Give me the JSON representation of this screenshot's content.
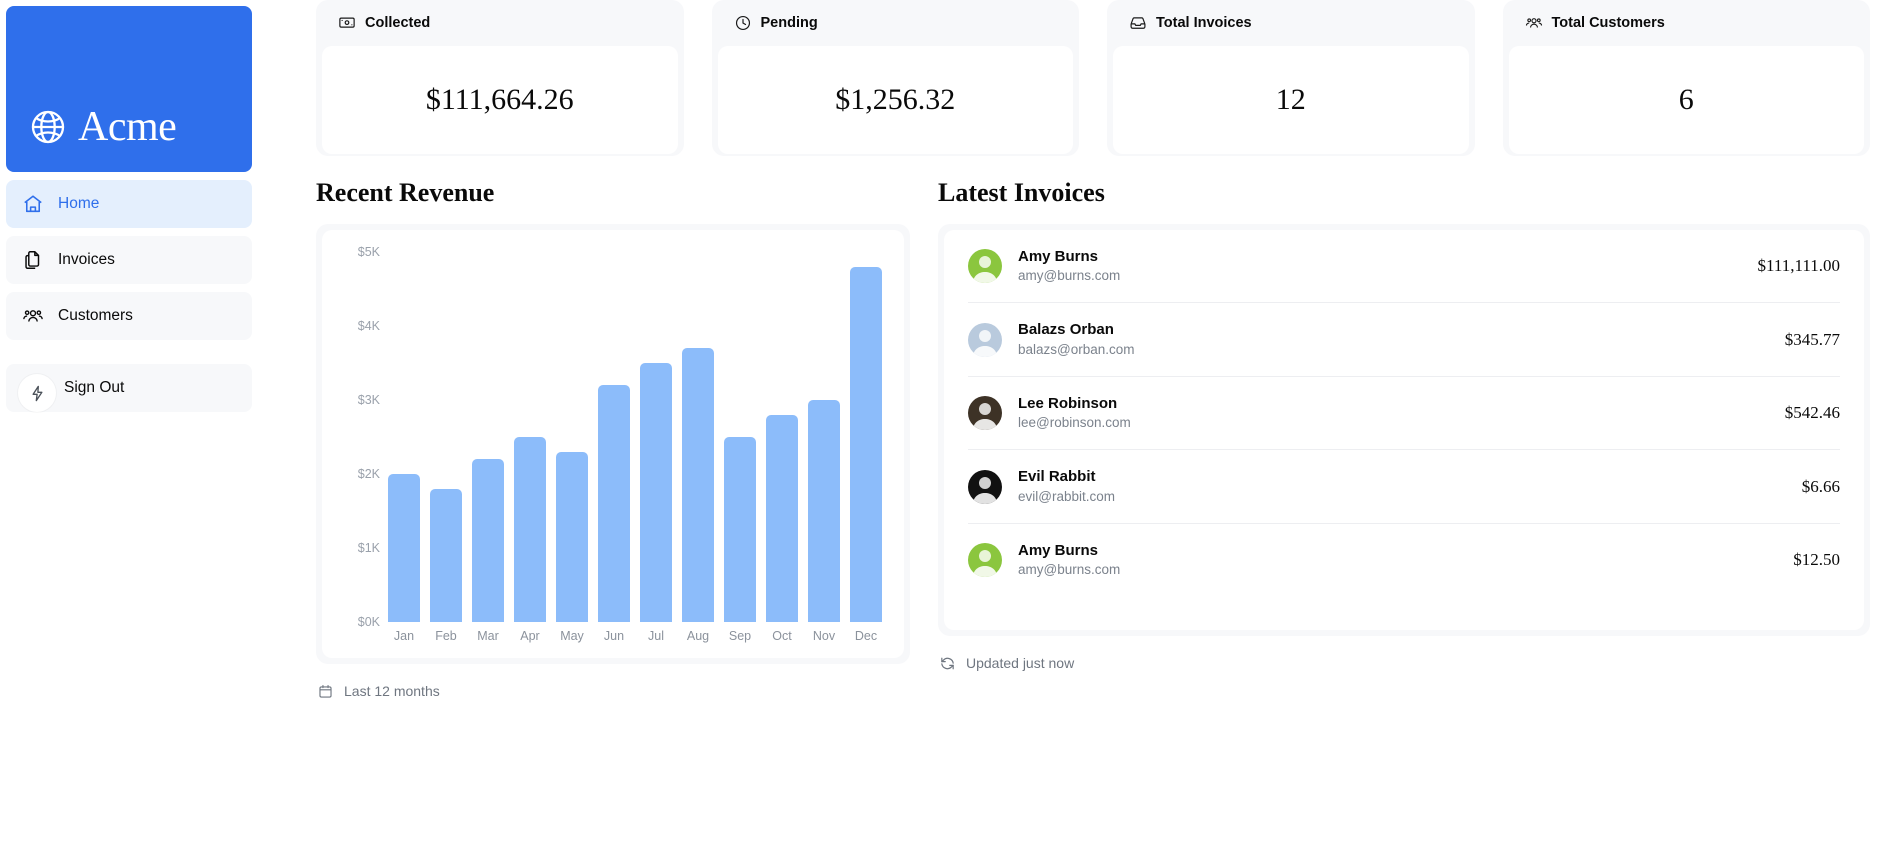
{
  "sidebar": {
    "logo": {
      "text": "Acme",
      "icon": "globe-icon",
      "bg_color": "#2f6feb"
    },
    "items": [
      {
        "label": "Home",
        "icon": "home-icon",
        "active": true
      },
      {
        "label": "Invoices",
        "icon": "documents-icon",
        "active": false
      },
      {
        "label": "Customers",
        "icon": "users-icon",
        "active": false
      }
    ],
    "sign_out": {
      "label": "Sign Out",
      "icon": "power-icon"
    }
  },
  "cards": [
    {
      "label": "Collected",
      "icon": "banknotes-icon",
      "value": "$111,664.26"
    },
    {
      "label": "Pending",
      "icon": "clock-icon",
      "value": "$1,256.32"
    },
    {
      "label": "Total Invoices",
      "icon": "inbox-icon",
      "value": "12"
    },
    {
      "label": "Total Customers",
      "icon": "users-icon",
      "value": "6"
    }
  ],
  "revenue": {
    "title": "Recent Revenue",
    "footer": {
      "label": "Last 12 months",
      "icon": "calendar-icon"
    }
  },
  "invoices": {
    "title": "Latest Invoices",
    "footer": {
      "label": "Updated just now",
      "icon": "refresh-icon"
    },
    "rows": [
      {
        "name": "Amy Burns",
        "email": "amy@burns.com",
        "amount": "$111,111.00",
        "avatar_color": "#8bc63e"
      },
      {
        "name": "Balazs Orban",
        "email": "balazs@orban.com",
        "amount": "$345.77",
        "avatar_color": "#b9cadd"
      },
      {
        "name": "Lee Robinson",
        "email": "lee@robinson.com",
        "amount": "$542.46",
        "avatar_color": "#3d3226"
      },
      {
        "name": "Evil Rabbit",
        "email": "evil@rabbit.com",
        "amount": "$6.66",
        "avatar_color": "#111111"
      },
      {
        "name": "Amy Burns",
        "email": "amy@burns.com",
        "amount": "$12.50",
        "avatar_color": "#8bc63e"
      }
    ]
  },
  "chart_data": {
    "type": "bar",
    "title": "Recent Revenue",
    "xlabel": "",
    "ylabel": "",
    "categories": [
      "Jan",
      "Feb",
      "Mar",
      "Apr",
      "May",
      "Jun",
      "Jul",
      "Aug",
      "Sep",
      "Oct",
      "Nov",
      "Dec"
    ],
    "values": [
      2000,
      1800,
      2200,
      2500,
      2300,
      3200,
      3500,
      3700,
      2500,
      2800,
      3000,
      4800
    ],
    "y_ticks": [
      "$0K",
      "$1K",
      "$2K",
      "$3K",
      "$4K",
      "$5K"
    ],
    "y_tick_values": [
      0,
      1000,
      2000,
      3000,
      4000,
      5000
    ],
    "ylim": [
      0,
      5000
    ],
    "grid": false,
    "legend": false,
    "bar_color": "#8cbcfa"
  },
  "theme": {
    "accent": "#2f6feb",
    "card_bg": "#f7f8fa",
    "bar": "#8cbcfa",
    "muted_text": "#7b828c"
  }
}
